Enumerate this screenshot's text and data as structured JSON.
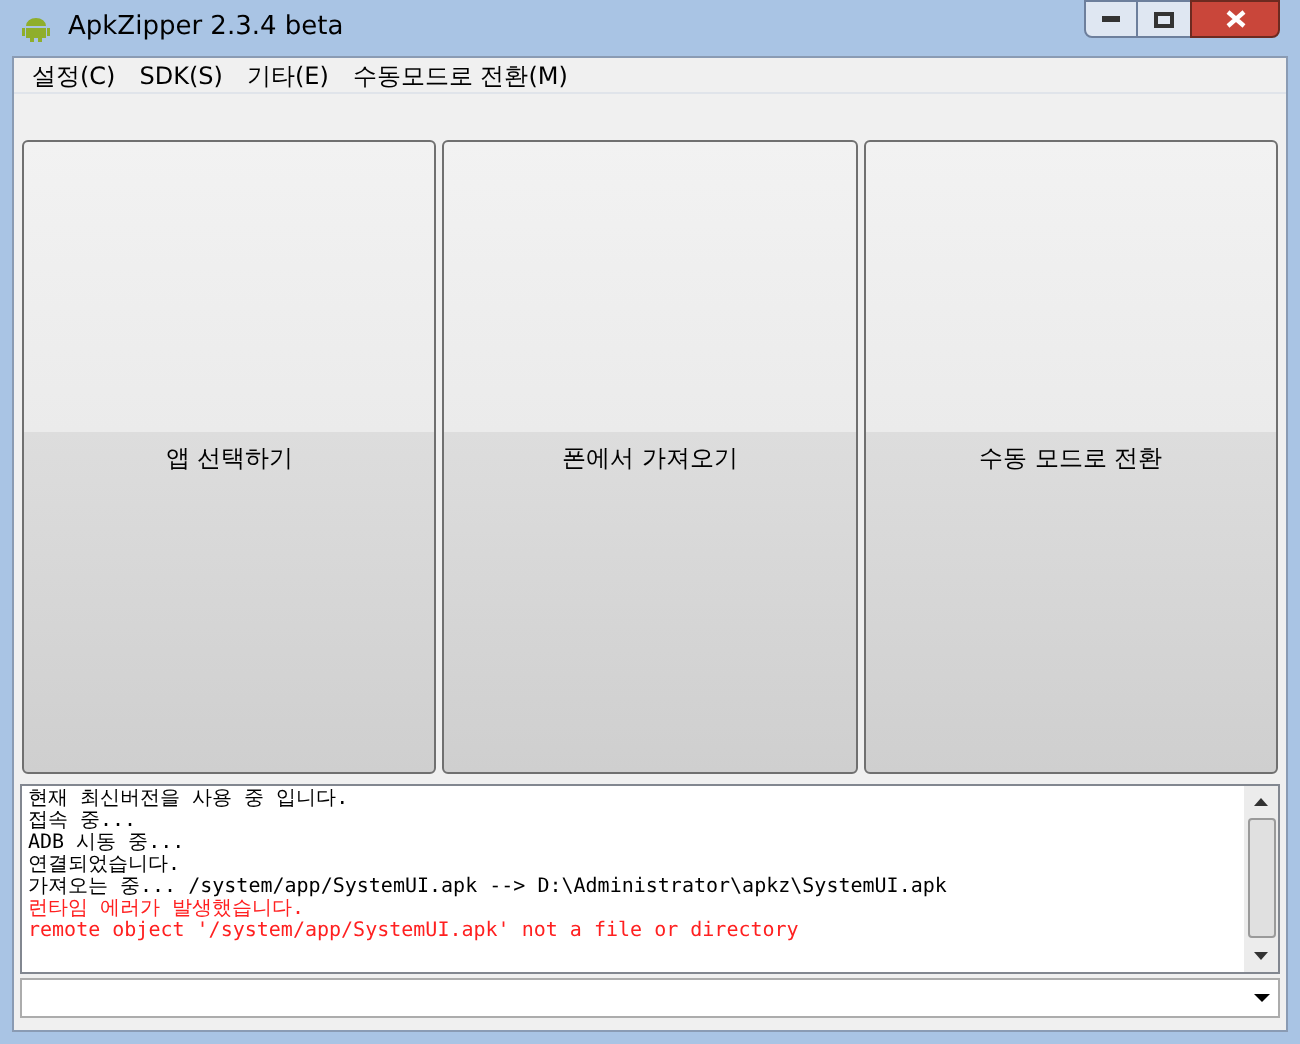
{
  "window": {
    "title": "ApkZipper 2.3.4 beta"
  },
  "menu": [
    "설정(C)",
    "SDK(S)",
    "기타(E)",
    "수동모드로 전환(M)"
  ],
  "actions": [
    "앱 선택하기",
    "폰에서 가져오기",
    "수동 모드로 전환"
  ],
  "log": [
    {
      "kind": "info",
      "text": "현재 최신버전을 사용 중 입니다."
    },
    {
      "kind": "info",
      "text": "접속 중..."
    },
    {
      "kind": "info",
      "text": "ADB 시동 중..."
    },
    {
      "kind": "info",
      "text": "연결되었습니다."
    },
    {
      "kind": "info",
      "text": "가져오는 중... /system/app/SystemUI.apk --> D:\\Administrator\\apkz\\SystemUI.apk"
    },
    {
      "kind": "error",
      "text": "런타임 에러가 발생했습니다."
    },
    {
      "kind": "error",
      "text": "remote object '/system/app/SystemUI.apk' not a file or directory"
    }
  ]
}
